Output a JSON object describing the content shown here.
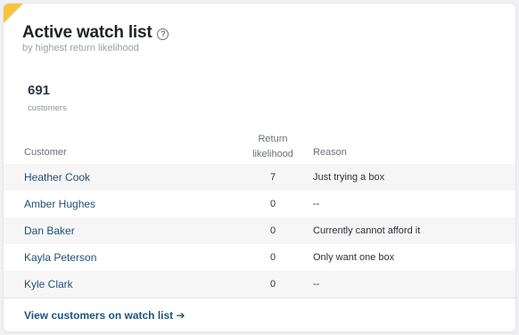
{
  "card": {
    "title": "Active watch list",
    "help_icon": "question-circle-icon",
    "subtitle": "by highest return likelihood",
    "accent_color": "#f6c445"
  },
  "metric": {
    "value": "691",
    "label": "customers"
  },
  "table": {
    "headers": {
      "customer": "Customer",
      "likelihood": "Return likelihood",
      "reason": "Reason"
    },
    "rows": [
      {
        "name": "Heather Cook",
        "likelihood": "7",
        "reason": "Just trying a box"
      },
      {
        "name": "Amber Hughes",
        "likelihood": "0",
        "reason": "--"
      },
      {
        "name": "Dan Baker",
        "likelihood": "0",
        "reason": "Currently cannot afford it"
      },
      {
        "name": "Kayla Peterson",
        "likelihood": "0",
        "reason": "Only want one box"
      },
      {
        "name": "Kyle Clark",
        "likelihood": "0",
        "reason": "--"
      }
    ]
  },
  "footer": {
    "link_label": "View customers on watch list ➔"
  }
}
